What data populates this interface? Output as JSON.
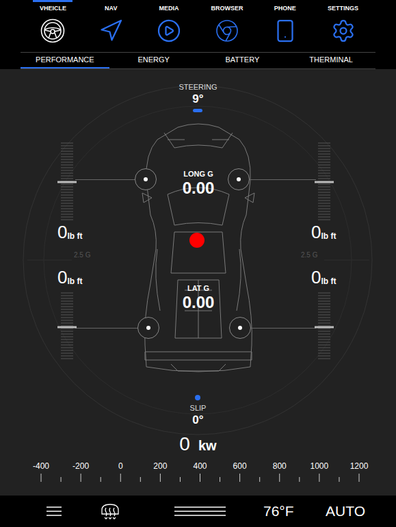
{
  "nav": [
    {
      "label": "VHEICLE",
      "selected": true
    },
    {
      "label": "NAV",
      "selected": false
    },
    {
      "label": "MEDIA",
      "selected": false
    },
    {
      "label": "BROWSER",
      "selected": false
    },
    {
      "label": "PHONE",
      "selected": false
    },
    {
      "label": "SETTINGS",
      "selected": false
    }
  ],
  "tabs": [
    {
      "label": "PERFORMANCE",
      "selected": true
    },
    {
      "label": "ENERGY",
      "selected": false
    },
    {
      "label": "BATTERY",
      "selected": false
    },
    {
      "label": "THERMINAL",
      "selected": false
    }
  ],
  "steering": {
    "label": "STEERING",
    "reading": "9°"
  },
  "long_g": {
    "label": "LONG G",
    "reading": "0.00"
  },
  "lat_g": {
    "label": "LAT G",
    "reading": "0.00"
  },
  "g_scale_labels": [
    "2.5 G",
    "2.5 G"
  ],
  "wheels": [
    {
      "position": "front-left",
      "torque": "0",
      "unit": "lb ft",
      "level": 0.5
    },
    {
      "position": "front-right",
      "torque": "0",
      "unit": "lb ft",
      "level": 0.5
    },
    {
      "position": "rear-left",
      "torque": "0",
      "unit": "lb ft",
      "level": 0.5
    },
    {
      "position": "rear-right",
      "torque": "0",
      "unit": "lb ft",
      "level": 0.5
    }
  ],
  "slip": {
    "label": "SLIP",
    "reading": "0°"
  },
  "power": {
    "reading": "0",
    "unit": "kw",
    "scale": [
      "-400",
      "-200",
      "0",
      "200",
      "400",
      "600",
      "800",
      "1000",
      "1200"
    ]
  },
  "climate": {
    "temperature": "76°F",
    "mode": "AUTO"
  }
}
